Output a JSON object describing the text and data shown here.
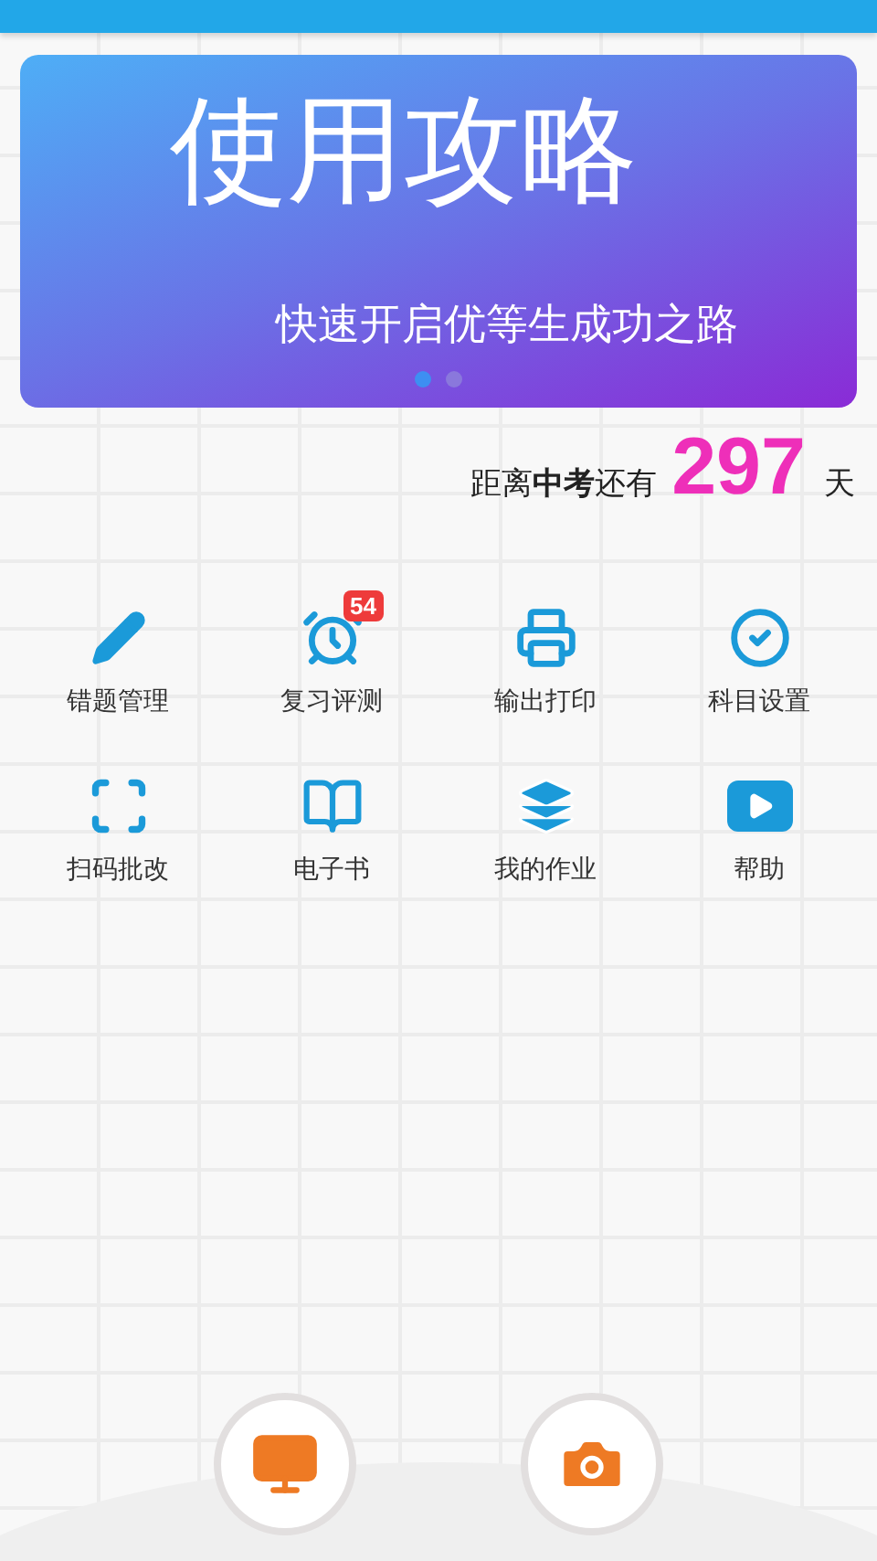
{
  "banner": {
    "title": "使用攻略",
    "subtitle": "快速开启优等生成功之路",
    "dots": [
      {
        "selected": true
      },
      {
        "selected": false
      }
    ]
  },
  "countdown": {
    "prefix": "距离",
    "exam": "中考",
    "middle": "还有",
    "days": "297",
    "unit": "天"
  },
  "grid": [
    {
      "label": "错题管理"
    },
    {
      "label": "复习评测",
      "badge": "54"
    },
    {
      "label": "输出打印"
    },
    {
      "label": "科目设置"
    },
    {
      "label": "扫码批改"
    },
    {
      "label": "电子书"
    },
    {
      "label": "我的作业"
    },
    {
      "label": "帮助"
    }
  ]
}
